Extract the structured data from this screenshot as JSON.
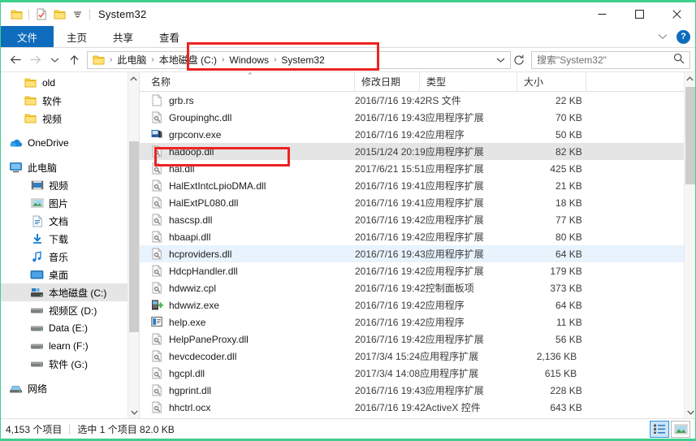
{
  "window": {
    "title": "System32",
    "accent_border": "#3ecf8e",
    "quick_access": [
      {
        "name": "folder-icon",
        "label": "文件夹"
      },
      {
        "name": "properties-icon",
        "label": "属性"
      },
      {
        "name": "new-folder-icon",
        "label": "新建文件夹"
      }
    ],
    "controls": {
      "minimize": "─",
      "maximize": "☐",
      "close": "✕"
    }
  },
  "ribbon": {
    "tabs": [
      {
        "label": "文件",
        "active": true
      },
      {
        "label": "主页",
        "active": false
      },
      {
        "label": "共享",
        "active": false
      },
      {
        "label": "查看",
        "active": false
      }
    ],
    "collapse_icon": "⌄",
    "help_label": "?"
  },
  "addressbar": {
    "back_icon": "←",
    "forward_icon": "→",
    "recent_icon": "⌄",
    "up_icon": "↑",
    "crumbs": [
      "此电脑",
      "本地磁盘 (C:)",
      "Windows",
      "System32"
    ],
    "separator": "›",
    "dropdown_icon": "⌄",
    "refresh_icon": "↻"
  },
  "search": {
    "placeholder": "搜索\"System32\"",
    "icon": "search-icon"
  },
  "sidebar": {
    "items": [
      {
        "label": "old",
        "icon": "folder-icon",
        "indent": 1,
        "selected": false
      },
      {
        "label": "软件",
        "icon": "folder-icon",
        "indent": 1,
        "selected": false
      },
      {
        "label": "视频",
        "icon": "folder-icon",
        "indent": 1,
        "selected": false
      },
      {
        "label": "OneDrive",
        "icon": "onedrive-icon",
        "indent": 0,
        "selected": false
      },
      {
        "label": "此电脑",
        "icon": "this-pc-icon",
        "indent": 0,
        "selected": false
      },
      {
        "label": "视频",
        "icon": "videos-icon",
        "indent": 1,
        "selected": false
      },
      {
        "label": "图片",
        "icon": "pictures-icon",
        "indent": 1,
        "selected": false
      },
      {
        "label": "文档",
        "icon": "documents-icon",
        "indent": 1,
        "selected": false
      },
      {
        "label": "下载",
        "icon": "downloads-icon",
        "indent": 1,
        "selected": false
      },
      {
        "label": "音乐",
        "icon": "music-icon",
        "indent": 1,
        "selected": false
      },
      {
        "label": "桌面",
        "icon": "desktop-icon",
        "indent": 1,
        "selected": false
      },
      {
        "label": "本地磁盘 (C:)",
        "icon": "system-drive-icon",
        "indent": 1,
        "selected": true
      },
      {
        "label": "视频区 (D:)",
        "icon": "drive-icon",
        "indent": 1,
        "selected": false
      },
      {
        "label": "Data (E:)",
        "icon": "drive-icon",
        "indent": 1,
        "selected": false
      },
      {
        "label": "learn (F:)",
        "icon": "drive-icon",
        "indent": 1,
        "selected": false
      },
      {
        "label": "软件 (G:)",
        "icon": "drive-icon",
        "indent": 1,
        "selected": false
      },
      {
        "label": "网络",
        "icon": "network-icon",
        "indent": 0,
        "selected": false
      }
    ]
  },
  "filelist": {
    "columns": [
      {
        "key": "name",
        "label": "名称",
        "sorted": true,
        "sort_caret": "⌃"
      },
      {
        "key": "date",
        "label": "修改日期"
      },
      {
        "key": "type",
        "label": "类型"
      },
      {
        "key": "size",
        "label": "大小"
      }
    ],
    "rows": [
      {
        "name": "grb.rs",
        "date": "2016/7/16 19:42",
        "type": "RS 文件",
        "size": "22 KB",
        "icon": "generic-file-icon",
        "state": ""
      },
      {
        "name": "Groupinghc.dll",
        "date": "2016/7/16 19:43",
        "type": "应用程序扩展",
        "size": "70 KB",
        "icon": "dll-icon",
        "state": ""
      },
      {
        "name": "grpconv.exe",
        "date": "2016/7/16 19:42",
        "type": "应用程序",
        "size": "50 KB",
        "icon": "grpconv-exe-icon",
        "state": ""
      },
      {
        "name": "hadoop.dll",
        "date": "2015/1/24 20:19",
        "type": "应用程序扩展",
        "size": "82 KB",
        "icon": "dll-icon",
        "state": "selected"
      },
      {
        "name": "hal.dll",
        "date": "2017/6/21 15:51",
        "type": "应用程序扩展",
        "size": "425 KB",
        "icon": "dll-icon",
        "state": ""
      },
      {
        "name": "HalExtIntcLpioDMA.dll",
        "date": "2016/7/16 19:41",
        "type": "应用程序扩展",
        "size": "21 KB",
        "icon": "dll-icon",
        "state": ""
      },
      {
        "name": "HalExtPL080.dll",
        "date": "2016/7/16 19:41",
        "type": "应用程序扩展",
        "size": "18 KB",
        "icon": "dll-icon",
        "state": ""
      },
      {
        "name": "hascsp.dll",
        "date": "2016/7/16 19:42",
        "type": "应用程序扩展",
        "size": "77 KB",
        "icon": "dll-icon",
        "state": ""
      },
      {
        "name": "hbaapi.dll",
        "date": "2016/7/16 19:42",
        "type": "应用程序扩展",
        "size": "80 KB",
        "icon": "dll-icon",
        "state": ""
      },
      {
        "name": "hcproviders.dll",
        "date": "2016/7/16 19:43",
        "type": "应用程序扩展",
        "size": "64 KB",
        "icon": "dll-icon",
        "state": "hover"
      },
      {
        "name": "HdcpHandler.dll",
        "date": "2016/7/16 19:42",
        "type": "应用程序扩展",
        "size": "179 KB",
        "icon": "dll-icon",
        "state": ""
      },
      {
        "name": "hdwwiz.cpl",
        "date": "2016/7/16 19:42",
        "type": "控制面板项",
        "size": "373 KB",
        "icon": "dll-icon",
        "state": ""
      },
      {
        "name": "hdwwiz.exe",
        "date": "2016/7/16 19:42",
        "type": "应用程序",
        "size": "64 KB",
        "icon": "hdwwiz-exe-icon",
        "state": ""
      },
      {
        "name": "help.exe",
        "date": "2016/7/16 19:42",
        "type": "应用程序",
        "size": "11 KB",
        "icon": "help-exe-icon",
        "state": ""
      },
      {
        "name": "HelpPaneProxy.dll",
        "date": "2016/7/16 19:42",
        "type": "应用程序扩展",
        "size": "56 KB",
        "icon": "dll-icon",
        "state": ""
      },
      {
        "name": "hevcdecoder.dll",
        "date": "2017/3/4 15:24",
        "type": "应用程序扩展",
        "size": "2,136 KB",
        "icon": "dll-icon",
        "state": ""
      },
      {
        "name": "hgcpl.dll",
        "date": "2017/3/4 14:08",
        "type": "应用程序扩展",
        "size": "615 KB",
        "icon": "dll-icon",
        "state": ""
      },
      {
        "name": "hgprint.dll",
        "date": "2016/7/16 19:43",
        "type": "应用程序扩展",
        "size": "228 KB",
        "icon": "dll-icon",
        "state": ""
      },
      {
        "name": "hhctrl.ocx",
        "date": "2016/7/16 19:42",
        "type": "ActiveX 控件",
        "size": "643 KB",
        "icon": "dll-icon",
        "state": ""
      }
    ]
  },
  "statusbar": {
    "item_count": "4,153 个项目",
    "selection": "选中 1 个项目  82.0 KB",
    "details_view": "details-view-icon",
    "large_icons_view": "large-icons-view-icon"
  },
  "annotations": {
    "color": "#ee2222",
    "path_box": "本地磁盘 (C:) > Windows > System32",
    "file_box": "hadoop.dll"
  }
}
